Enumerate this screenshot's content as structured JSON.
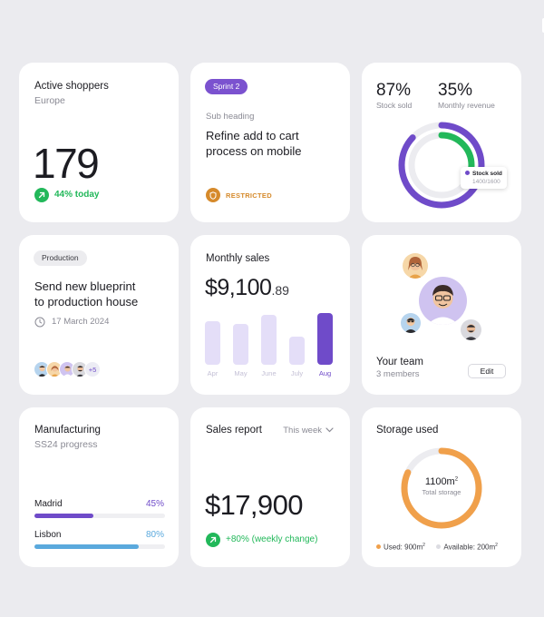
{
  "colors": {
    "accent_purple": "#6f4bc9",
    "accent_green": "#22b85a",
    "accent_orange": "#f0a04b",
    "accent_blue": "#5aa9dd",
    "restricted_orange": "#d68a2b"
  },
  "active_shoppers": {
    "title": "Active shoppers",
    "region": "Europe",
    "count": "179",
    "change_icon": "arrow-up-right-icon",
    "change": "44% today"
  },
  "task": {
    "sprint": "Sprint 2",
    "subheading": "Sub heading",
    "description_line1": "Refine add to cart",
    "description_line2": "process on mobile",
    "status_icon": "shield-icon",
    "status": "RESTRICTED"
  },
  "stock": {
    "stock_sold_pct": "87%",
    "stock_sold_label": "Stock sold",
    "revenue_pct": "35%",
    "revenue_label": "Monthly revenue",
    "stock_sold_value": 0.87,
    "revenue_value": 0.35,
    "tooltip_label": "Stock sold",
    "tooltip_value": "1400/1600"
  },
  "production": {
    "tag": "Production",
    "title_line1": "Send new blueprint",
    "title_line2": "to production house",
    "date_icon": "clock-icon",
    "date": "17 March 2024",
    "extra_members": "+5"
  },
  "monthly_sales": {
    "title": "Monthly sales",
    "amount_main": "$9,100",
    "amount_cents": ".89"
  },
  "chart_data": {
    "type": "bar",
    "title": "",
    "categories": [
      "Apr",
      "May",
      "June",
      "July",
      "Aug"
    ],
    "values": [
      48,
      45,
      55,
      31,
      57
    ],
    "highlighted": "Aug",
    "ylim": [
      0,
      60
    ],
    "grid": false,
    "xlabel": "",
    "ylabel": ""
  },
  "team": {
    "title": "Your team",
    "members": "3 members",
    "edit_label": "Edit"
  },
  "manufacturing": {
    "title": "Manufacturing",
    "subtitle": "SS24 progress",
    "rows": [
      {
        "label": "Madrid",
        "pct": "45%",
        "value": 0.45,
        "color": "#6f4bc9"
      },
      {
        "label": "Lisbon",
        "pct": "80%",
        "value": 0.8,
        "color": "#5aa9dd"
      }
    ]
  },
  "sales_report": {
    "title": "Sales report",
    "period": "This week",
    "amount": "$17,900",
    "change_icon": "arrow-up-right-icon",
    "change": "+80% (weekly change)"
  },
  "storage": {
    "title": "Storage used",
    "total_value": "1100m",
    "total_unit_sup": "2",
    "total_label": "Total storage",
    "used_label": "Used: 900m",
    "available_label": "Available: 200m",
    "sup": "2",
    "used_fraction": 0.818
  }
}
